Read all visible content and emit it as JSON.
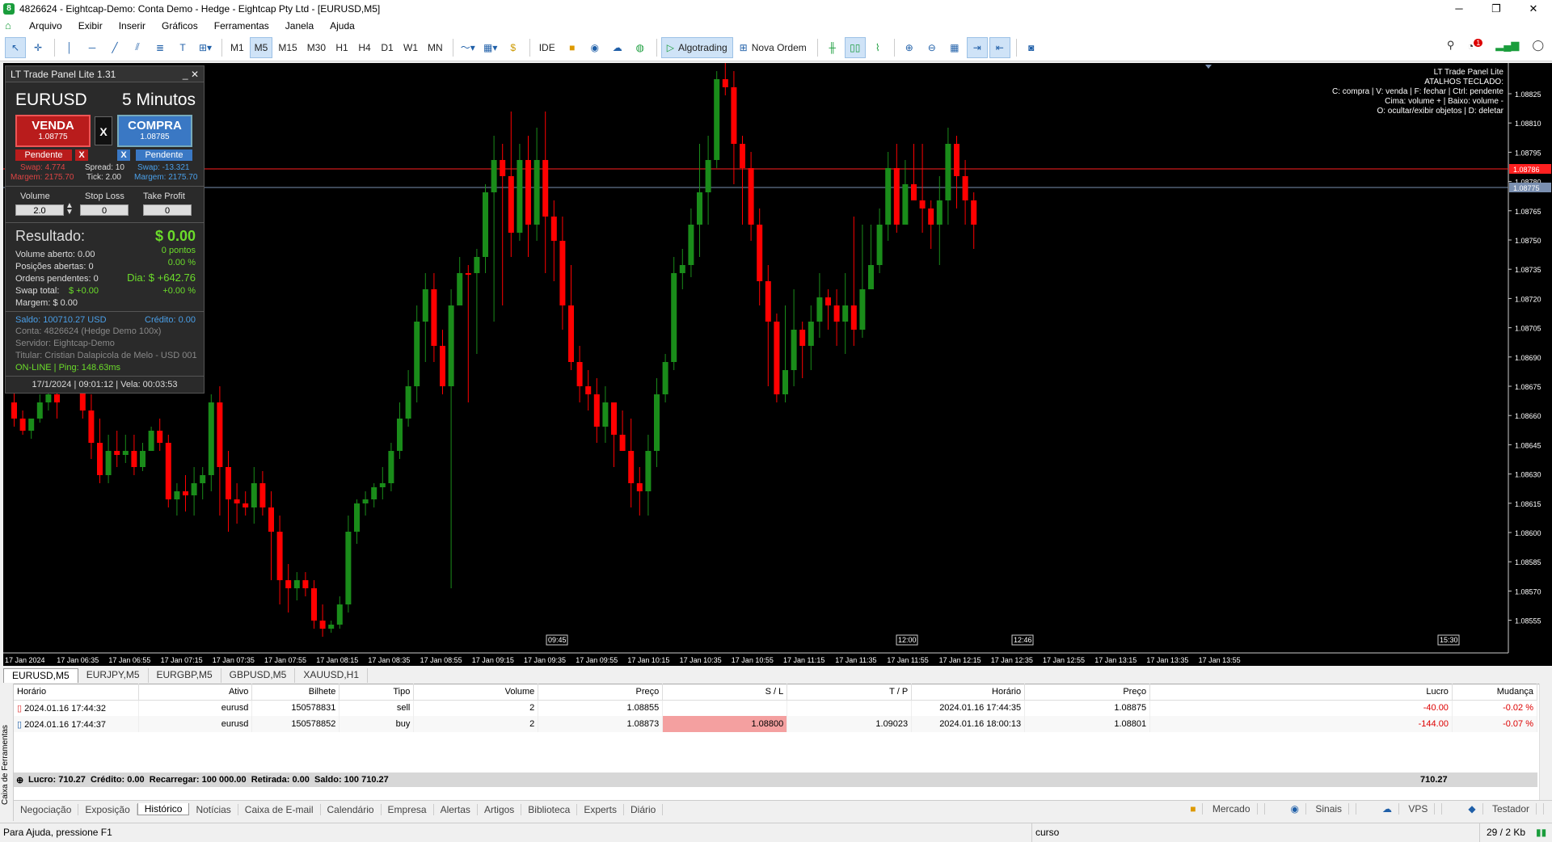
{
  "window": {
    "title": "4826624 - Eightcap-Demo: Conta Demo - Hedge - Eightcap Pty Ltd - [EURUSD,M5]"
  },
  "menu": [
    "Arquivo",
    "Exibir",
    "Inserir",
    "Gráficos",
    "Ferramentas",
    "Janela",
    "Ajuda"
  ],
  "toolbar": {
    "timeframes": [
      "M1",
      "M5",
      "M15",
      "M30",
      "H1",
      "H4",
      "D1",
      "W1",
      "MN"
    ],
    "selected_tf": "M5",
    "ide": "IDE",
    "algotrading": "Algotrading",
    "nova_ordem": "Nova Ordem",
    "notif_count": "1"
  },
  "chart": {
    "symbol": "EURUSD,M5",
    "shortcuts_title": "LT Trade Panel Lite",
    "shortcuts": [
      "ATALHOS TECLADO:",
      "C: compra | V: venda | F: fechar | Ctrl: pendente",
      "Cima: volume + | Baixo: volume -",
      "O: ocultar/exibir objetos | D: deletar"
    ],
    "price_labels": [
      "1.08825",
      "1.08810",
      "1.08795",
      "1.08780",
      "1.08765",
      "1.08750",
      "1.08735",
      "1.08720",
      "1.08705",
      "1.08690",
      "1.08675",
      "1.08660",
      "1.08645",
      "1.08630",
      "1.08615",
      "1.08600",
      "1.08585",
      "1.08570",
      "1.08555"
    ],
    "bid_tag": "1.08786",
    "ask_tag": "1.08775",
    "time_labels": [
      "17 Jan 2024",
      "17 Jan 06:35",
      "17 Jan 06:55",
      "17 Jan 07:15",
      "17 Jan 07:35",
      "17 Jan 07:55",
      "17 Jan 08:15",
      "17 Jan 08:35",
      "17 Jan 08:55",
      "17 Jan 09:15",
      "17 Jan 09:35",
      "17 Jan 09:55",
      "17 Jan 10:15",
      "17 Jan 10:35",
      "17 Jan 10:55",
      "17 Jan 11:15",
      "17 Jan 11:35",
      "17 Jan 11:55",
      "17 Jan 12:15",
      "17 Jan 12:35",
      "17 Jan 12:55",
      "17 Jan 13:15",
      "17 Jan 13:35",
      "17 Jan 13:55"
    ],
    "marker_labels": [
      "09:45",
      "12:00",
      "12:46",
      "15:30"
    ],
    "colors": {
      "up": "#1a8c1a",
      "down": "#ff0000",
      "bg": "#000000"
    }
  },
  "panel": {
    "title": "LT Trade Panel Lite 1.31",
    "symbol": "EURUSD",
    "timeframe": "5 Minutos",
    "sell_label": "VENDA",
    "sell_price": "1.08775",
    "buy_label": "COMPRA",
    "buy_price": "1.08785",
    "x": "X",
    "pending": "Pendente",
    "swap_sell": "Swap: 4.774",
    "spread": "Spread: 10",
    "swap_buy": "Swap: -13.321",
    "margin_sell": "Margem: 2175.70",
    "tick": "Tick: 2.00",
    "margin_buy": "Margem: 2175.70",
    "volume_label": "Volume",
    "sl_label": "Stop Loss",
    "tp_label": "Take Profit",
    "volume": "2.0",
    "sl": "0",
    "tp": "0",
    "result_label": "Resultado:",
    "result_value": "$ 0.00",
    "points": "0 pontos",
    "pct": "0.00 %",
    "volume_open": "Volume aberto: 0.00",
    "positions": "Posições abertas: 0",
    "pending_orders": "Ordens pendentes: 0",
    "day": "Dia: $ +642.76",
    "swap_total_label": "Swap total:",
    "swap_total": "$ +0.00",
    "day_pct": "+0.00 %",
    "margin": "Margem: $ 0.00",
    "balance": "Saldo: 100710.27 USD",
    "credit": "Crédito: 0.00",
    "account": "Conta: 4826624 (Hedge Demo 100x)",
    "server": "Servidor: Eightcap-Demo",
    "holder": "Titular: Cristian Dalapicola de Melo - USD 001",
    "online": "ON-LINE | Ping: 148.63ms",
    "footer": "17/1/2024 | 09:01:12 | Vela: 00:03:53"
  },
  "symbol_tabs": [
    "EURUSD,M5",
    "EURJPY,M5",
    "EURGBP,M5",
    "GBPUSD,M5",
    "XAUUSD,H1"
  ],
  "history": {
    "headers": [
      "Horário",
      "Ativo",
      "Bilhete",
      "Tipo",
      "Volume",
      "Preço",
      "S / L",
      "T / P",
      "Horário",
      "Preço",
      "Lucro",
      "Mudança"
    ],
    "rows": [
      [
        "2024.01.16 17:44:32",
        "eurusd",
        "150578831",
        "sell",
        "2",
        "1.08855",
        "",
        "",
        "2024.01.16 17:44:35",
        "1.08875",
        "-40.00",
        "-0.02 %"
      ],
      [
        "2024.01.16 17:44:37",
        "eurusd",
        "150578852",
        "buy",
        "2",
        "1.08873",
        "1.08800",
        "1.09023",
        "2024.01.16 18:00:13",
        "1.08801",
        "-144.00",
        "-0.07 %"
      ]
    ],
    "summary": "Lucro: 710.27  Crédito: 0.00  Recarregar: 100 000.00  Retirada: 0.00  Saldo: 100 710.27",
    "total": "710.27"
  },
  "side_label": "Caixa de Ferramentas",
  "bottom_tabs": [
    "Negociação",
    "Exposição",
    "Histórico",
    "Notícias",
    "Caixa de E-mail",
    "Calendário",
    "Empresa",
    "Alertas",
    "Artigos",
    "Biblioteca",
    "Experts",
    "Diário"
  ],
  "bottom_right": [
    "Mercado",
    "Sinais",
    "VPS",
    "Testador"
  ],
  "status": {
    "help": "Para Ajuda, pressione F1",
    "mode": "curso",
    "traffic": "29 / 2 Kb"
  }
}
